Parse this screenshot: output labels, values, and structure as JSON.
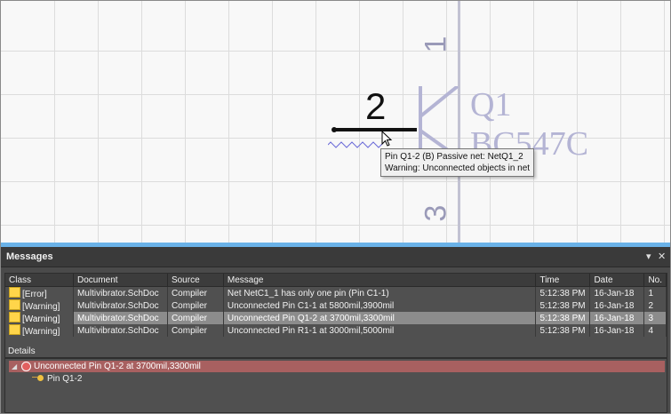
{
  "canvas": {
    "pin_number_top": "1",
    "pin_number_left": "2",
    "pin_number_bottom": "3",
    "designator": "Q1",
    "part_name": "BC547C",
    "tooltip": {
      "line1": "Pin Q1-2 (B) Passive    net: NetQ1_2",
      "line2": "Warning: Unconnected objects in net"
    }
  },
  "panel": {
    "title": "Messages",
    "pin_icon": "▾",
    "close_icon": "✕",
    "columns": [
      "Class",
      "Document",
      "Source",
      "Message",
      "Time",
      "Date",
      "No."
    ],
    "rows": [
      {
        "class": "[Error]",
        "document": "Multivibrator.SchDoc",
        "source": "Compiler",
        "message": "Net NetC1_1 has only one pin (Pin C1-1)",
        "time": "5:12:38 PM",
        "date": "16-Jan-18",
        "no": "1",
        "selected": false
      },
      {
        "class": "[Warning]",
        "document": "Multivibrator.SchDoc",
        "source": "Compiler",
        "message": "Unconnected Pin C1-1 at 5800mil,3900mil",
        "time": "5:12:38 PM",
        "date": "16-Jan-18",
        "no": "2",
        "selected": false
      },
      {
        "class": "[Warning]",
        "document": "Multivibrator.SchDoc",
        "source": "Compiler",
        "message": "Unconnected Pin Q1-2 at 3700mil,3300mil",
        "time": "5:12:38 PM",
        "date": "16-Jan-18",
        "no": "3",
        "selected": true
      },
      {
        "class": "[Warning]",
        "document": "Multivibrator.SchDoc",
        "source": "Compiler",
        "message": "Unconnected Pin R1-1 at 3000mil,5000mil",
        "time": "5:12:38 PM",
        "date": "16-Jan-18",
        "no": "4",
        "selected": false
      }
    ],
    "details_label": "Details",
    "details": {
      "message": "Unconnected Pin Q1-2 at 3700mil,3300mil",
      "child": "Pin Q1-2"
    }
  },
  "colors": {
    "accent": "#6ab2e8",
    "error_row": "#a86060",
    "warning_icon": "#ffd54a",
    "symbol": "#b4b4d4"
  }
}
